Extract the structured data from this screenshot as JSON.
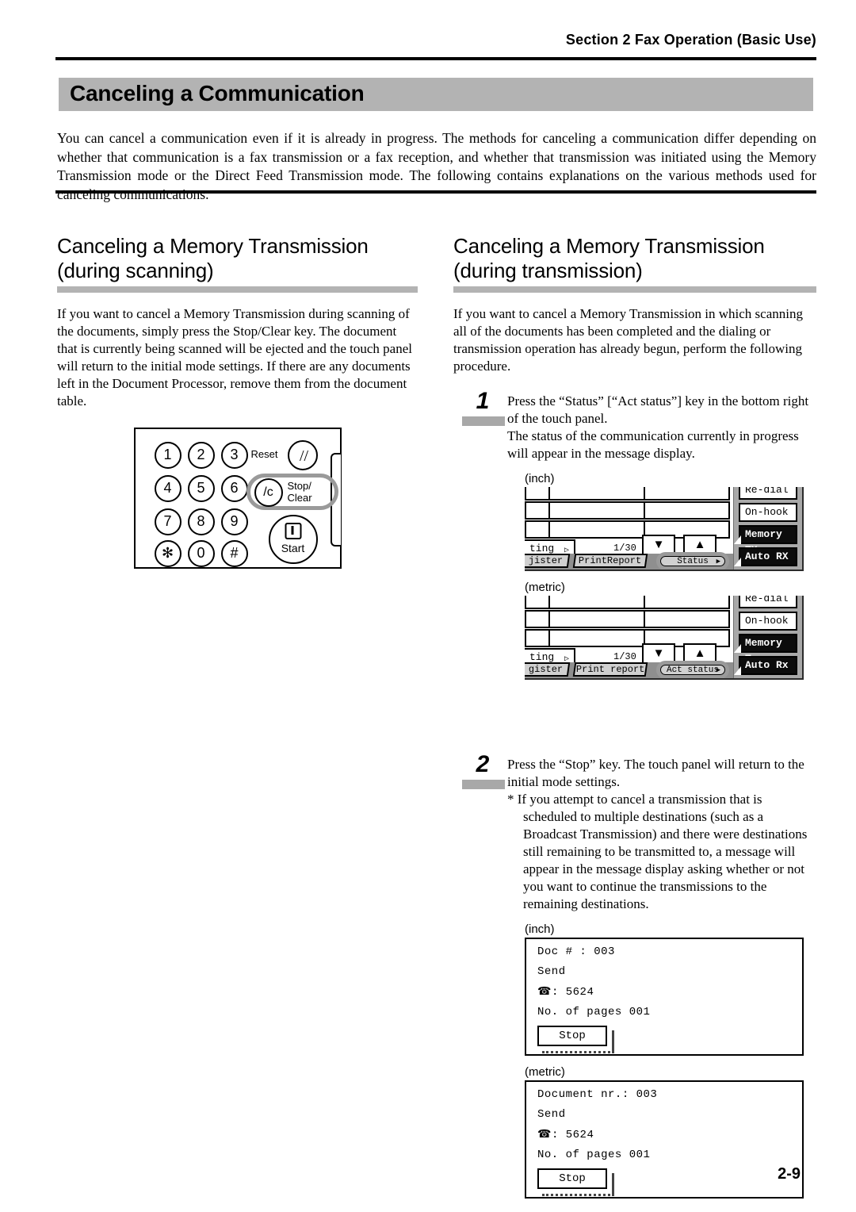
{
  "header": {
    "running_head": "Section 2  Fax Operation (Basic Use)"
  },
  "title": "Canceling a Communication",
  "intro": "You can cancel a communication even if it is already in progress. The methods for canceling a communication differ depending on whether that communication is a fax transmission or a fax reception, and whether that transmission was initiated using the Memory Transmission mode or the Direct Feed Transmission mode. The following contains explanations on the various methods used for canceling communications.",
  "left_column": {
    "heading_line1": "Canceling a Memory Transmission",
    "heading_line2": "(during scanning)",
    "body": "If you want to cancel a Memory Transmission during scanning of the documents, simply press the Stop/Clear key. The document that is currently being scanned will be ejected and the touch panel will return to the initial mode settings. If there are any documents left in the Document Processor, remove them from the document table.",
    "keypad": {
      "keys": [
        "1",
        "2",
        "3",
        "4",
        "5",
        "6",
        "7",
        "8",
        "9",
        "✻",
        "0",
        "#"
      ],
      "reset_label": "Reset",
      "reset_glyph": "//",
      "stopclear_label_line1": "Stop/",
      "stopclear_label_line2": "Clear",
      "stopclear_glyph": "/c",
      "start_label": "Start"
    }
  },
  "right_column": {
    "heading_line1": "Canceling a Memory Transmission",
    "heading_line2": "(during transmission)",
    "body": "If you want to cancel a Memory Transmission in which scanning all of the documents has been completed and the dialing or transmission operation has already begun, perform the following procedure.",
    "steps": [
      {
        "number": "1",
        "text_line1": "Press the “Status” [“Act status”] key in the bottom right of the touch panel.",
        "text_line2": "The status of the communication currently in progress will appear in the message display."
      },
      {
        "number": "2",
        "text_line1": "Press the “Stop” key. The touch panel will return to the initial mode settings.",
        "note": "* If you attempt to cancel a transmission that is scheduled to multiple destinations (such as a Broadcast Transmission) and there were destinations still remaining to be transmitted to, a message will appear in the message display asking whether or not you want to continue the transmissions to the remaining destinations."
      }
    ],
    "panels": [
      {
        "label": "(inch)",
        "tab_partial": "ting",
        "page_count": "1/30",
        "arrow_down": "▼",
        "arrow_up": "▲",
        "bottom_tab_register": "jister",
        "bottom_tab_print": "PrintReport",
        "status_key": "Status",
        "side_keys": [
          {
            "label": "Re-dial",
            "style": "light"
          },
          {
            "label": "On-hook",
            "style": "light"
          },
          {
            "label": "Memory TX",
            "style": "dark"
          },
          {
            "label": "Auto RX",
            "style": "dark"
          }
        ]
      },
      {
        "label": "(metric)",
        "tab_partial": "ting",
        "page_count": "1/30",
        "arrow_down": "▼",
        "arrow_up": "▲",
        "bottom_tab_register": "gister",
        "bottom_tab_print": "Print report",
        "status_key": "Act status",
        "side_keys": [
          {
            "label": "Re-dial",
            "style": "light"
          },
          {
            "label": "On-hook",
            "style": "light"
          },
          {
            "label": "Memory Tx",
            "style": "dark"
          },
          {
            "label": "Auto Rx",
            "style": "dark"
          }
        ]
      }
    ],
    "message_displays": [
      {
        "label": "(inch)",
        "doc_line": "Doc #   : 003",
        "direction": "Send",
        "phone_line": ": 5624",
        "pages_line": "No. of pages  001",
        "stop_label": "Stop"
      },
      {
        "label": "(metric)",
        "doc_line": "Document nr.: 003",
        "direction": "Send",
        "phone_line": ": 5624",
        "pages_line": "No. of pages  001",
        "stop_label": "Stop"
      }
    ]
  },
  "page_number": "2-9",
  "colors": {
    "band_gray": "#b3b3b3",
    "rule_black": "#000000"
  }
}
